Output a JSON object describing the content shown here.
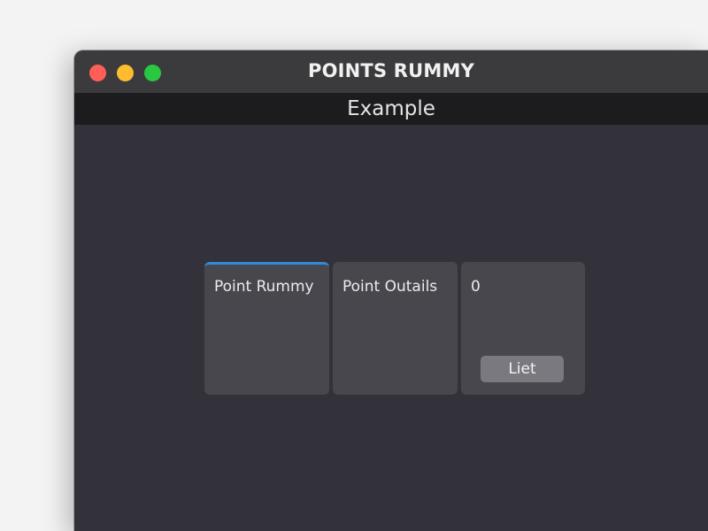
{
  "window": {
    "title": "POINTS RUMMY",
    "subtitle": "Example",
    "controls": {
      "close_color": "#ff5f57",
      "minimize_color": "#febc2e",
      "maximize_color": "#28c840"
    }
  },
  "cards": [
    {
      "label": "Point Rummy",
      "selected": true
    },
    {
      "label": "Point Outails",
      "selected": false
    },
    {
      "label": "0",
      "button_label": "Liet",
      "selected": false
    }
  ],
  "colors": {
    "window_bg": "#33323a",
    "titlebar_bg": "#3b3b3d",
    "subbar_bg": "#1c1c1e",
    "card_bg": "#48474d",
    "accent": "#2f8ad8",
    "button_bg": "#7a797f"
  }
}
